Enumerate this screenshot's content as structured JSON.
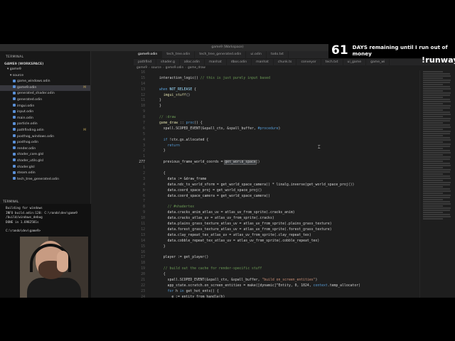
{
  "window": {
    "title": "game9 (Workspace)"
  },
  "explorer": {
    "title": "TERMINAL",
    "workspace": "GAME9 (WORKSPACE)",
    "folder_game9": "game9",
    "folder_source": "source",
    "items": [
      {
        "label": "game_windows.odin",
        "badge": ""
      },
      {
        "label": "game9.odin",
        "badge": "M"
      },
      {
        "label": "generated_shader.odin",
        "badge": ""
      },
      {
        "label": "generated.odin",
        "badge": ""
      },
      {
        "label": "imgui.odin",
        "badge": ""
      },
      {
        "label": "input.odin",
        "badge": ""
      },
      {
        "label": "main.odin",
        "badge": ""
      },
      {
        "label": "particle.odin",
        "badge": ""
      },
      {
        "label": "pathfinding.odin",
        "badge": "M"
      },
      {
        "label": "posthog_windows.odin",
        "badge": ""
      },
      {
        "label": "posthog.odin",
        "badge": ""
      },
      {
        "label": "render.odin",
        "badge": ""
      },
      {
        "label": "shader_core.glsl",
        "badge": ""
      },
      {
        "label": "shader_utils.glsl",
        "badge": ""
      },
      {
        "label": "shader.glsl",
        "badge": ""
      },
      {
        "label": "steam.odin",
        "badge": ""
      },
      {
        "label": "tech_tree_generated.odin",
        "badge": ""
      }
    ]
  },
  "terminal": {
    "label": "TERMINAL",
    "lines": [
      "Building for windows",
      "INFO build.odin:120: C:\\rando\\dev\\game9",
      "/build/windows_debug",
      "DONE in 1.6982581s"
    ],
    "prompt": "C:\\rando\\dev\\game9>"
  },
  "tabs_row1": [
    {
      "label": "game9.odin",
      "active": true
    },
    {
      "label": "tech_tree.odin",
      "active": false
    },
    {
      "label": "tech_tree_generated.odin",
      "active": false
    },
    {
      "label": "ui.odin",
      "active": false
    },
    {
      "label": "todo.txt",
      "active": false
    }
  ],
  "tabs_row2": [
    {
      "label": "pathfind",
      "active": false
    },
    {
      "label": "shader.g",
      "active": false
    },
    {
      "label": "alloc.odin",
      "active": false
    },
    {
      "label": "manhat",
      "active": false
    },
    {
      "label": "dbos.odin",
      "active": false
    },
    {
      "label": "manhat",
      "active": false
    },
    {
      "label": "chunk.ts",
      "active": false
    },
    {
      "label": "conveyor",
      "active": false
    },
    {
      "label": "tech.txt",
      "active": false
    },
    {
      "label": "ui_game",
      "active": false
    },
    {
      "label": "game_wi",
      "active": false
    }
  ],
  "breadcrumb": [
    "game9",
    "source",
    "game9.odin",
    "game_draw"
  ],
  "editor": {
    "lines": [
      {
        "n": "16",
        "tokens": []
      },
      {
        "n": "15",
        "tokens": [
          [
            "tx",
            "interaction_logic() "
          ],
          [
            "cm",
            "// this is just purely input based"
          ]
        ]
      },
      {
        "n": "14",
        "tokens": []
      },
      {
        "n": "13",
        "tokens": [
          [
            "kw",
            "when "
          ],
          [
            "id",
            "NOT_RELEASE"
          ],
          [
            "tx",
            " {"
          ]
        ]
      },
      {
        "n": "12",
        "tokens": [
          [
            "tx",
            "  "
          ],
          [
            "fn",
            "imgui_stuff"
          ],
          [
            "tx",
            "()"
          ]
        ]
      },
      {
        "n": "11",
        "tokens": [
          [
            "tx",
            "}"
          ]
        ]
      },
      {
        "n": "10",
        "tokens": [
          [
            "tx",
            "}"
          ]
        ]
      },
      {
        "n": "9",
        "tokens": []
      },
      {
        "n": "8",
        "tokens": [
          [
            "cm",
            "// :draw"
          ]
        ]
      },
      {
        "n": "7",
        "tokens": [
          [
            "fn",
            "game_draw"
          ],
          [
            "tx",
            " :: "
          ],
          [
            "kw",
            "proc"
          ],
          [
            "tx",
            "() {"
          ]
        ]
      },
      {
        "n": "6",
        "tokens": [
          [
            "tx",
            "  spall.SCOPED_EVENT(&spall_ctx, &spall_buffer, "
          ],
          [
            "kw",
            "#procedure"
          ],
          [
            "tx",
            ")"
          ]
        ]
      },
      {
        "n": "5",
        "tokens": []
      },
      {
        "n": "4",
        "tokens": [
          [
            "tx",
            "  "
          ],
          [
            "kw",
            "if"
          ],
          [
            "tx",
            " !ctx.gs.allocated {"
          ]
        ]
      },
      {
        "n": "3",
        "tokens": [
          [
            "tx",
            "    "
          ],
          [
            "kw",
            "return"
          ]
        ]
      },
      {
        "n": "2",
        "tokens": [
          [
            "tx",
            "  }"
          ]
        ]
      },
      {
        "n": "1",
        "tokens": []
      },
      {
        "n": "277",
        "current": true,
        "tokens": [
          [
            "tx",
            "  previous_frame_world_coords = "
          ],
          [
            "hl",
            "get_world_space"
          ],
          [
            "tx",
            "()"
          ]
        ]
      },
      {
        "n": "1",
        "tokens": []
      },
      {
        "n": "2",
        "tokens": [
          [
            "tx",
            "  {"
          ]
        ]
      },
      {
        "n": "3",
        "tokens": [
          [
            "tx",
            "    data := &draw_frame"
          ]
        ]
      },
      {
        "n": "4",
        "tokens": [
          [
            "tx",
            "    data.ndc_to_world_xform = get_world_space_camera() * linalg.inverse(get_world_space_proj())"
          ]
        ]
      },
      {
        "n": "5",
        "tokens": [
          [
            "tx",
            "    data.coord_space_proj = get_world_space_proj()"
          ]
        ]
      },
      {
        "n": "6",
        "tokens": [
          [
            "tx",
            "    data.coord_space_camera = get_world_space_camera()"
          ]
        ]
      },
      {
        "n": "7",
        "tokens": []
      },
      {
        "n": "8",
        "tokens": [
          [
            "tx",
            "    "
          ],
          [
            "cm",
            "// #shadertex"
          ]
        ]
      },
      {
        "n": "9",
        "tokens": [
          [
            "tx",
            "    data.cracks_anim_atlas_uv = atlas_uv_from_sprite(.cracks_anim)"
          ]
        ]
      },
      {
        "n": "10",
        "tokens": [
          [
            "tx",
            "    data.cracks_atlas_uv = atlas_uv_from_sprite(.cracks)"
          ]
        ]
      },
      {
        "n": "11",
        "tokens": [
          [
            "tx",
            "    data.plains_grass_texture_atlas_uv = atlas_uv_from_sprite(.plains_grass_texture)"
          ]
        ]
      },
      {
        "n": "12",
        "tokens": [
          [
            "tx",
            "    data.forest_grass_texture_atlas_uv = atlas_uv_from_sprite(.forest_grass_texture)"
          ]
        ]
      },
      {
        "n": "13",
        "tokens": [
          [
            "tx",
            "    data.clay_repeat_tex_atlas_uv = atlas_uv_from_sprite(.clay_repeat_tex)"
          ]
        ]
      },
      {
        "n": "14",
        "tokens": [
          [
            "tx",
            "    data.cobble_repeat_tex_atlas_uv = atlas_uv_from_sprite(.cobble_repeat_tex)"
          ]
        ]
      },
      {
        "n": "15",
        "tokens": [
          [
            "tx",
            "  }"
          ]
        ]
      },
      {
        "n": "16",
        "tokens": []
      },
      {
        "n": "17",
        "tokens": [
          [
            "tx",
            "  player := get_player()"
          ]
        ]
      },
      {
        "n": "18",
        "tokens": []
      },
      {
        "n": "19",
        "tokens": [
          [
            "tx",
            "  "
          ],
          [
            "cm",
            "// build out the cache for render-specific stuff"
          ]
        ]
      },
      {
        "n": "20",
        "tokens": [
          [
            "tx",
            "  {"
          ]
        ]
      },
      {
        "n": "21",
        "tokens": [
          [
            "tx",
            "    spall.SCOPED_EVENT(&spall_ctx, &spall_buffer, "
          ],
          [
            "st",
            "\"build on_screen_entities\""
          ],
          [
            "tx",
            ")"
          ]
        ]
      },
      {
        "n": "22",
        "tokens": [
          [
            "tx",
            "    app_state.scratch.on_screen_entities = make([dynamic]^Entity, 0, 1024, "
          ],
          [
            "kw",
            "context"
          ],
          [
            "tx",
            ".temp_allocator)"
          ]
        ]
      },
      {
        "n": "23",
        "tokens": [
          [
            "tx",
            "    "
          ],
          [
            "kw",
            "for"
          ],
          [
            "tx",
            " h "
          ],
          [
            "kw",
            "in"
          ],
          [
            "tx",
            " get_hot_ents() {"
          ]
        ]
      },
      {
        "n": "24",
        "tokens": [
          [
            "tx",
            "      e := entity_from_handle(h)"
          ]
        ]
      },
      {
        "n": "25",
        "tokens": [
          [
            "tx",
            "      "
          ],
          [
            "kw",
            "if"
          ],
          [
            "tx",
            " .allocated "
          ],
          [
            "kw",
            "in"
          ],
          [
            "tx",
            " e.flags && (is_entity_on_screen(e) || disable_bot_optimizations || e.flags) {"
          ]
        ]
      }
    ]
  },
  "overlay": {
    "days_number": "61",
    "days_text": "DAYS remaining until I run out of money",
    "logo": "runway"
  }
}
